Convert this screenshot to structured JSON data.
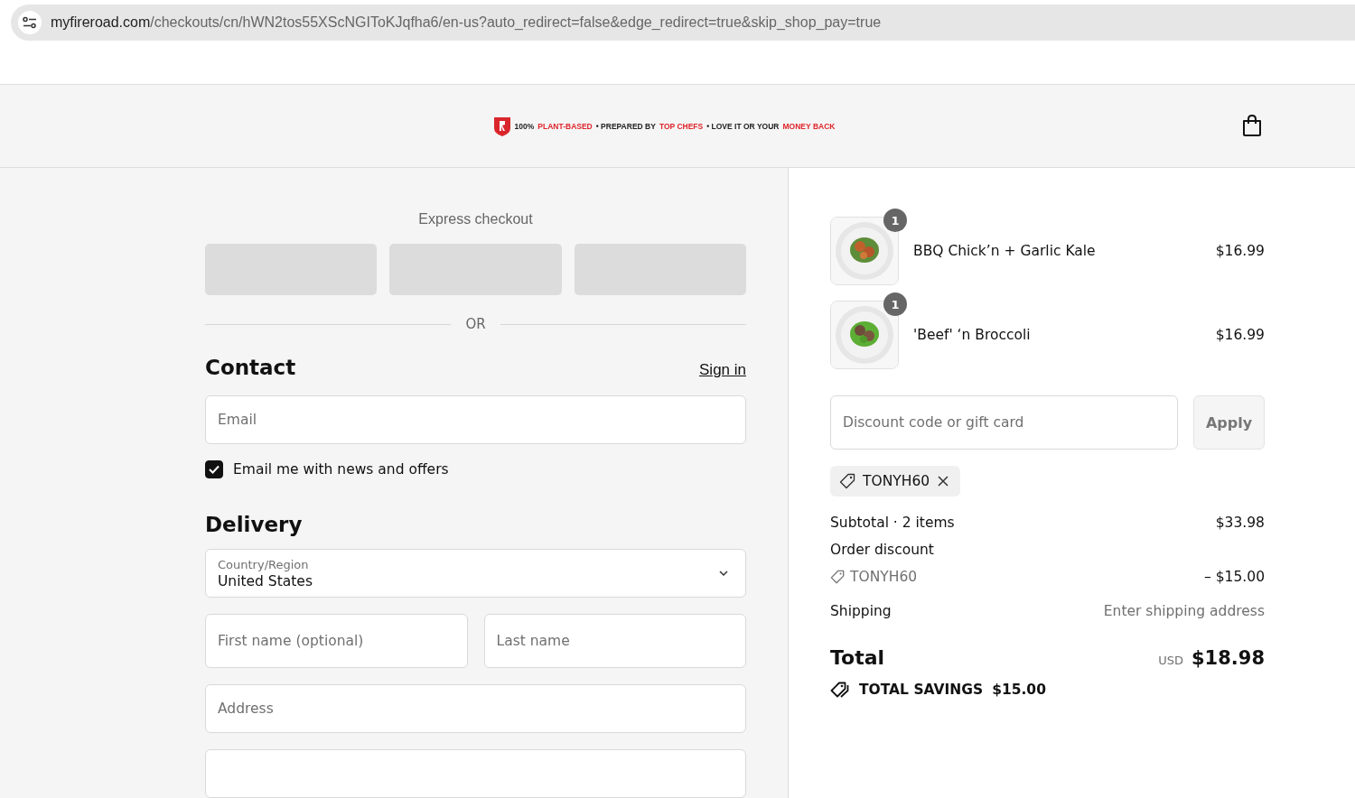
{
  "address_bar": {
    "domain": "myfireroad.com",
    "path": "/checkouts/cn/hWN2tos55XScNGIToKJqfha6/en-us?auto_redirect=false&edge_redirect=true&skip_shop_pay=true"
  },
  "banner": [
    {
      "text": "100%",
      "accent": false
    },
    {
      "text": "PLANT-BASED",
      "accent": true
    },
    {
      "text": "• PREPARED BY",
      "accent": false
    },
    {
      "text": "TOP CHEFS",
      "accent": true
    },
    {
      "text": "• LOVE IT OR YOUR",
      "accent": false
    },
    {
      "text": "MONEY BACK",
      "accent": true
    }
  ],
  "express_checkout": {
    "title": "Express checkout",
    "button_count_label": "OR"
  },
  "contact": {
    "heading": "Contact",
    "sign_in": "Sign in",
    "email_placeholder": "Email",
    "newsletter": {
      "label": "Email me with news and offers",
      "checked": true
    }
  },
  "delivery": {
    "heading": "Delivery",
    "country": {
      "label": "Country/Region",
      "value": "United States"
    },
    "first_name_placeholder": "First name (optional)",
    "last_name_placeholder": "Last name",
    "address_placeholder": "Address"
  },
  "items": [
    {
      "name": "BBQ Chick’n + Garlic Kale",
      "price": "$16.99",
      "quantity": "1",
      "kind": "picture"
    },
    {
      "name": "'Beef' ‘n Broccoli",
      "price": "$16.99",
      "quantity": "1",
      "kind": "picture"
    }
  ],
  "discount": {
    "placeholder": "Discount code or gift card",
    "apply": "Apply",
    "applied_code": "TONYH60"
  },
  "summary": {
    "subtotal_label": "Subtotal · 2 items",
    "subtotal": "$33.98",
    "order_discount_label": "Order discount",
    "discount_code": "TONYH60",
    "discount_amount": "– $15.00",
    "shipping_label": "Shipping",
    "shipping_value": "Enter shipping address",
    "total_label": "Total",
    "currency": "USD",
    "total": "$18.98",
    "savings_label": "TOTAL SAVINGS",
    "savings": "$15.00"
  }
}
